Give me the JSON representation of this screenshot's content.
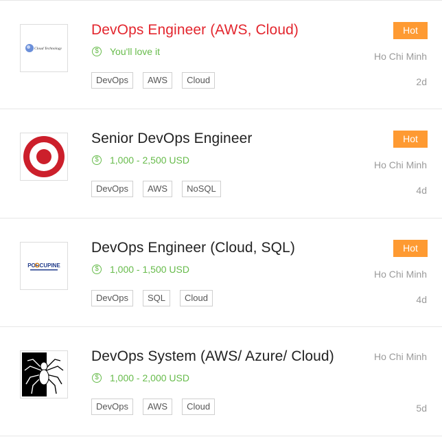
{
  "jobs": [
    {
      "title": "DevOps Engineer (AWS, Cloud)",
      "salary": "You'll love it",
      "salary_icon": "$",
      "tags": [
        "DevOps",
        "AWS",
        "Cloud"
      ],
      "badge": "Hot",
      "location": "Ho Chi Minh",
      "posted": "2d",
      "logo_text": "Cloud Technology"
    },
    {
      "title": "Senior DevOps Engineer",
      "salary": "1,000 - 2,500 USD",
      "salary_icon": "$",
      "tags": [
        "DevOps",
        "AWS",
        "NoSQL"
      ],
      "badge": "Hot",
      "location": "Ho Chi Minh",
      "posted": "4d"
    },
    {
      "title": "DevOps Engineer (Cloud, SQL)",
      "salary": "1,000 - 1,500 USD",
      "salary_icon": "$",
      "tags": [
        "DevOps",
        "SQL",
        "Cloud"
      ],
      "badge": "Hot",
      "location": "Ho Chi Minh",
      "posted": "4d",
      "logo_text": "PORCUPINE"
    },
    {
      "title": "DevOps System (AWS/ Azure/ Cloud)",
      "salary": "1,000 - 2,000 USD",
      "salary_icon": "$",
      "tags": [
        "DevOps",
        "AWS",
        "Cloud"
      ],
      "location": "Ho Chi Minh",
      "posted": "5d"
    }
  ],
  "colors": {
    "hot_badge": "#fe9a32",
    "salary_green": "#66bb4a",
    "active_title_red": "#e3262e"
  }
}
